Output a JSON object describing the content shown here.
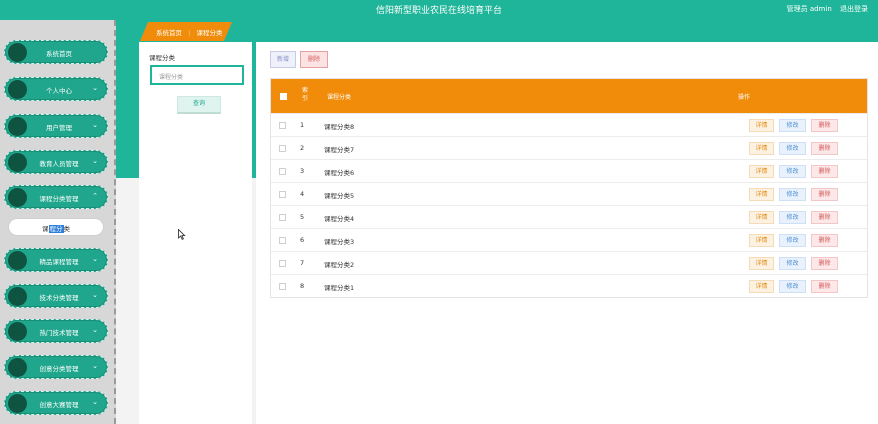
{
  "header": {
    "title": "信阳新型职业农民在线培育平台",
    "admin_label": "管理员 admin",
    "logout_label": "退出登录"
  },
  "sidebar": {
    "items": [
      {
        "label": "系统首页",
        "chevron": ""
      },
      {
        "label": "个人中心",
        "chevron": "⌄"
      },
      {
        "label": "用户管理",
        "chevron": "⌄"
      },
      {
        "label": "教育人员管理",
        "chevron": "⌄"
      },
      {
        "label": "课程分类管理",
        "chevron": "⌃"
      },
      {
        "label": "精品课程管理",
        "chevron": "⌄"
      },
      {
        "label": "技术分类管理",
        "chevron": "⌄"
      },
      {
        "label": "热门技术管理",
        "chevron": "⌄"
      },
      {
        "label": "创意分类管理",
        "chevron": "⌄"
      },
      {
        "label": "创意大赛管理",
        "chevron": "⌄"
      }
    ],
    "sub_item": {
      "before": "课",
      "highlight": "程分",
      "after": "类"
    }
  },
  "breadcrumb": {
    "home": "系统首页",
    "separator": "⋮",
    "current": "课程分类"
  },
  "search": {
    "label": "课程分类",
    "placeholder": "课程分类",
    "button": "查询"
  },
  "toolbar": {
    "add_label": "新增",
    "delete_label": "删除"
  },
  "table": {
    "headers": {
      "index": "索\n引",
      "name": "课程分类",
      "actions": "操作"
    },
    "rows": [
      {
        "index": "1",
        "name": "课程分类8"
      },
      {
        "index": "2",
        "name": "课程分类7"
      },
      {
        "index": "3",
        "name": "课程分类6"
      },
      {
        "index": "4",
        "name": "课程分类5"
      },
      {
        "index": "5",
        "name": "课程分类4"
      },
      {
        "index": "6",
        "name": "课程分类3"
      },
      {
        "index": "7",
        "name": "课程分类2"
      },
      {
        "index": "8",
        "name": "课程分类1"
      }
    ],
    "actions": {
      "detail": "详情",
      "edit": "修改",
      "delete": "删除"
    }
  },
  "colors": {
    "brand": "#1fb59a",
    "accent": "#f08c0a"
  }
}
